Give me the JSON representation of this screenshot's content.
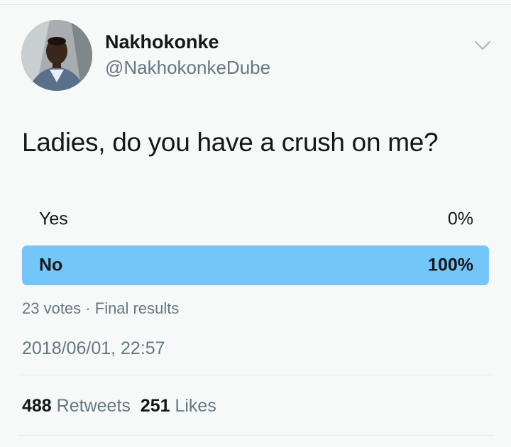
{
  "tweet": {
    "author": {
      "display_name": "Nakhokonke",
      "handle": "@NakhokonkeDube"
    },
    "menu_icon": "chevron-down-icon",
    "text": "Ladies, do you have a crush on me?",
    "poll": {
      "options": [
        {
          "label": "Yes",
          "percent_text": "0%",
          "fraction": 0.0,
          "winner": false
        },
        {
          "label": "No",
          "percent_text": "100%",
          "fraction": 1.0,
          "winner": true
        }
      ],
      "votes_text": "23 votes",
      "separator": "·",
      "status_text": "Final results"
    },
    "timestamp": "2018/06/01, 22:57",
    "stats": {
      "retweets_count": "488",
      "retweets_label": "Retweets",
      "likes_count": "251",
      "likes_label": "Likes"
    }
  },
  "colors": {
    "winner_fill": "#74c6f8",
    "loser_fill": "#e1e8ed",
    "text_primary": "#14171a",
    "text_secondary": "#657786"
  }
}
